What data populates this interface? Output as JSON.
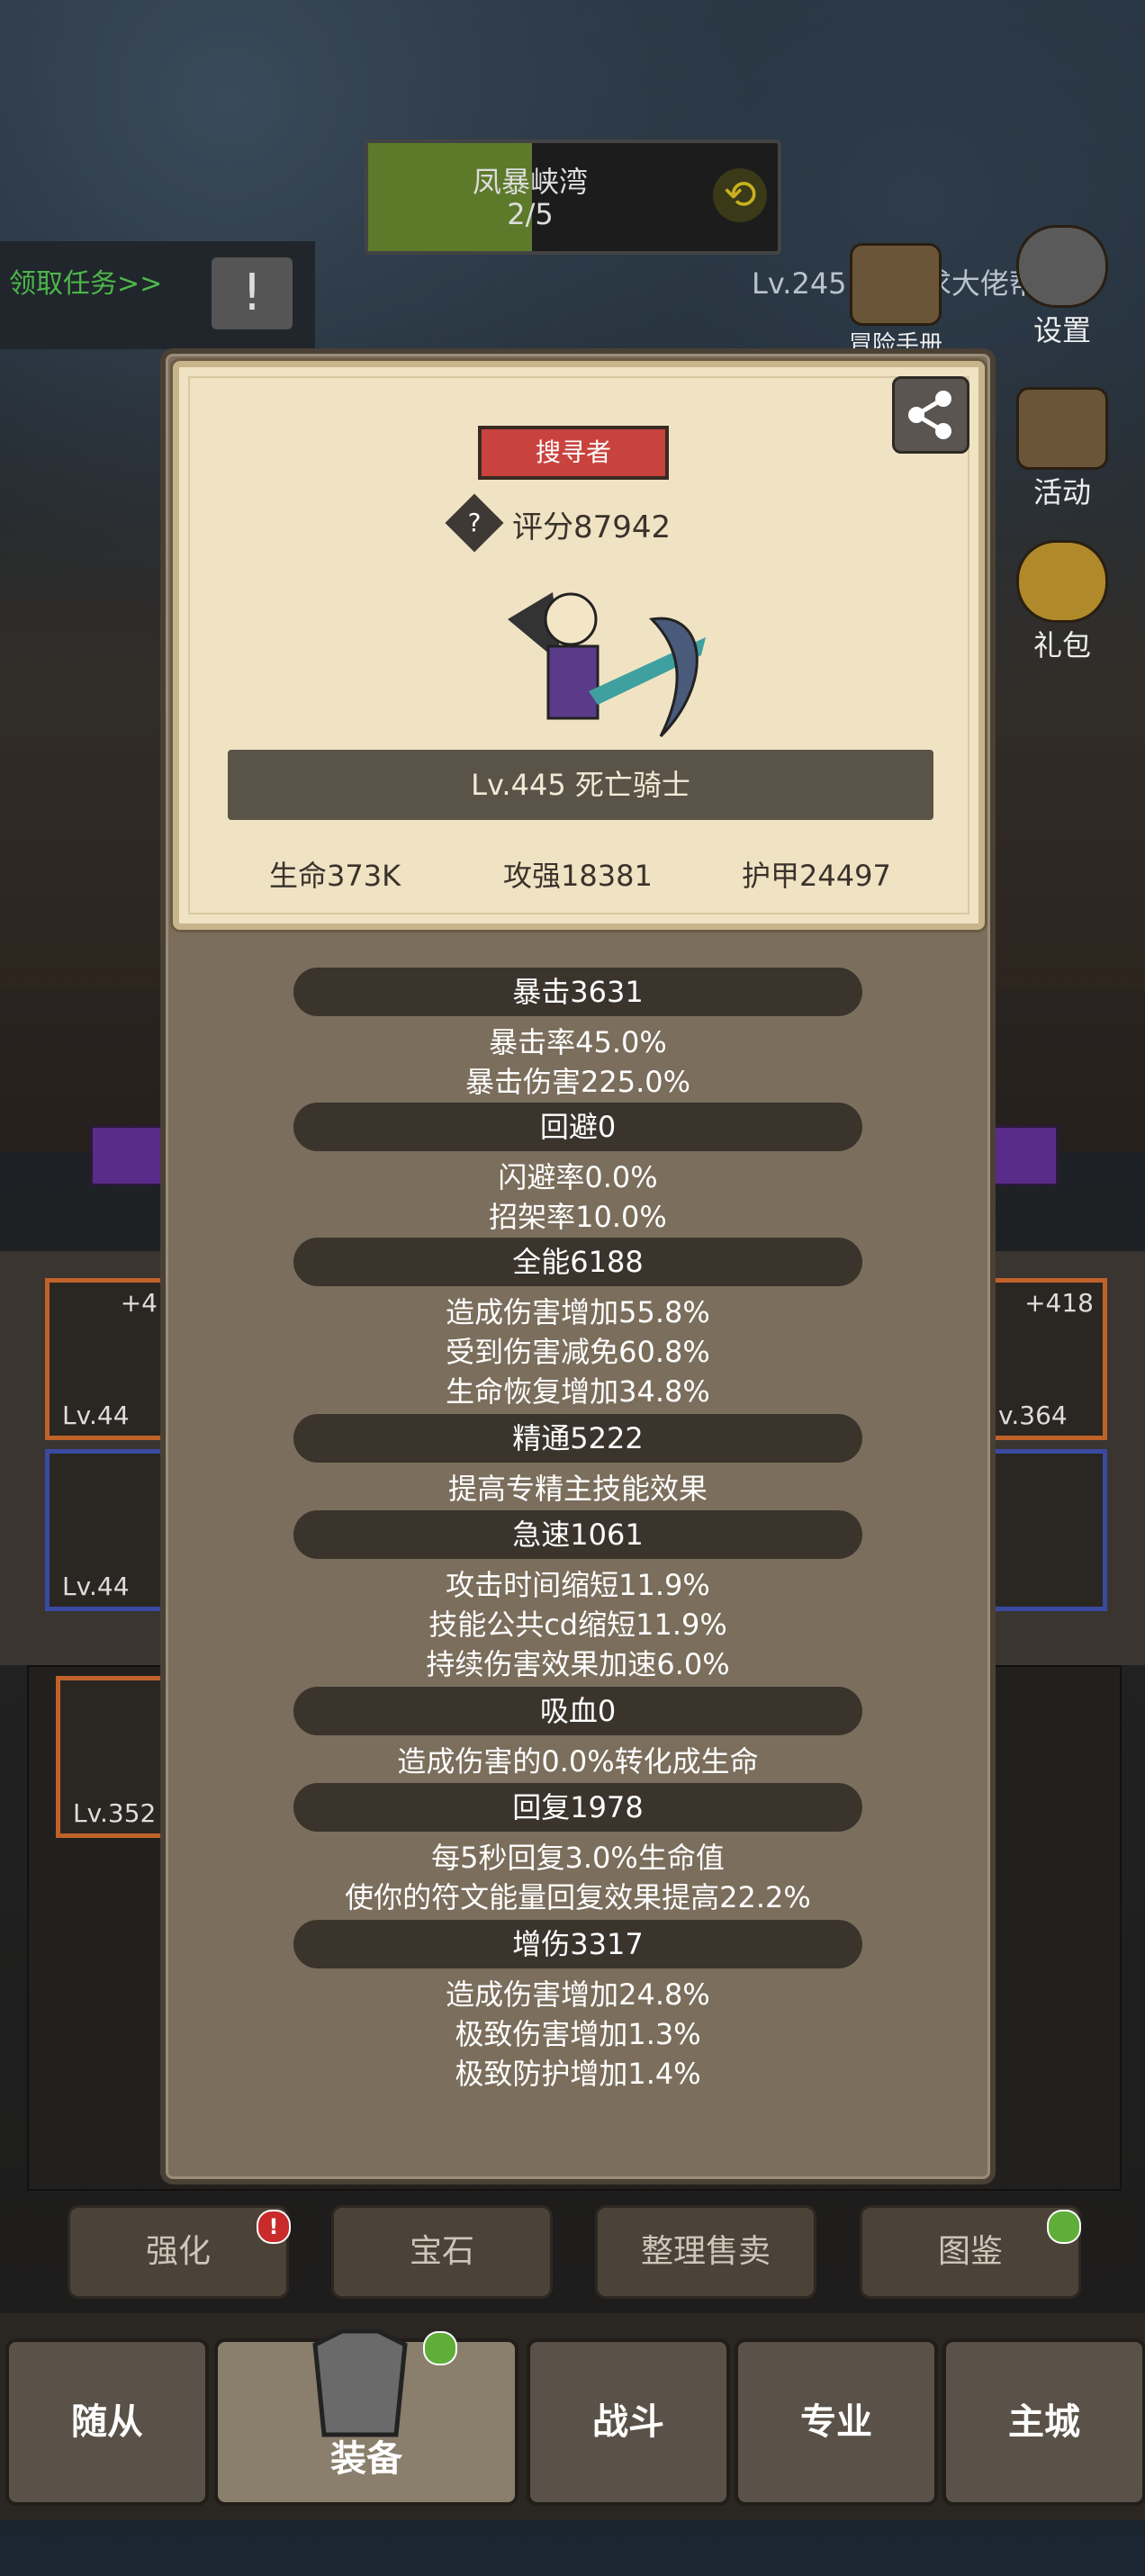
{
  "stage": {
    "name": "凤暴峡湾",
    "progress": "2/5",
    "progress_fraction": 0.4
  },
  "task": {
    "label": "领取任务>>"
  },
  "title_hint": "Lv.245 骑士  求大佬帮我",
  "side_menu": [
    {
      "label": "冒险手册",
      "icon": "book-icon"
    },
    {
      "label": "设置",
      "icon": "gear-icon"
    },
    {
      "label": "活动",
      "icon": "scroll-icon"
    },
    {
      "label": "礼包",
      "icon": "gift-icon"
    }
  ],
  "equip": {
    "slots": [
      {
        "level": "Lv.44",
        "plus": "+4"
      },
      {
        "level": "Lv.44",
        "plus": ""
      },
      {
        "level": "Lv.352",
        "plus": ""
      },
      {
        "level": "v.364",
        "plus": "+418"
      }
    ]
  },
  "card": {
    "badge": "搜寻者",
    "score": "评分87942",
    "name": "Lv.445 死亡骑士",
    "hp": "生命373K",
    "attack": "攻强18381",
    "armor": "护甲24497"
  },
  "stat_groups": [
    {
      "header": "暴击3631",
      "lines": [
        "暴击率45.0%",
        "暴击伤害225.0%"
      ]
    },
    {
      "header": "回避0",
      "lines": [
        "闪避率0.0%",
        "招架率10.0%"
      ]
    },
    {
      "header": "全能6188",
      "lines": [
        "造成伤害增加55.8%",
        "受到伤害减免60.8%",
        "生命恢复增加34.8%"
      ]
    },
    {
      "header": "精通5222",
      "lines": [
        "提高专精主技能效果"
      ]
    },
    {
      "header": "急速1061",
      "lines": [
        "攻击时间缩短11.9%",
        "技能公共cd缩短11.9%",
        "持续伤害效果加速6.0%"
      ]
    },
    {
      "header": "吸血0",
      "lines": [
        "造成伤害的0.0%转化成生命"
      ]
    },
    {
      "header": "回复1978",
      "lines": [
        "每5秒回复3.0%生命值",
        "使你的符文能量回复效果提高22.2%"
      ]
    },
    {
      "header": "增伤3317",
      "lines": [
        "造成伤害增加24.8%",
        "极致伤害增加1.3%",
        "极致防护增加1.4%"
      ]
    }
  ],
  "function_buttons": [
    "强化",
    "宝石",
    "整理售卖",
    "图鉴"
  ],
  "nav": [
    "随从",
    "装备",
    "战斗",
    "专业",
    "主城"
  ],
  "colors": {
    "badge": "#c9433e",
    "panel": "#7b6e5c",
    "card": "#f0e3c4",
    "header_pill": "#3a342d"
  }
}
